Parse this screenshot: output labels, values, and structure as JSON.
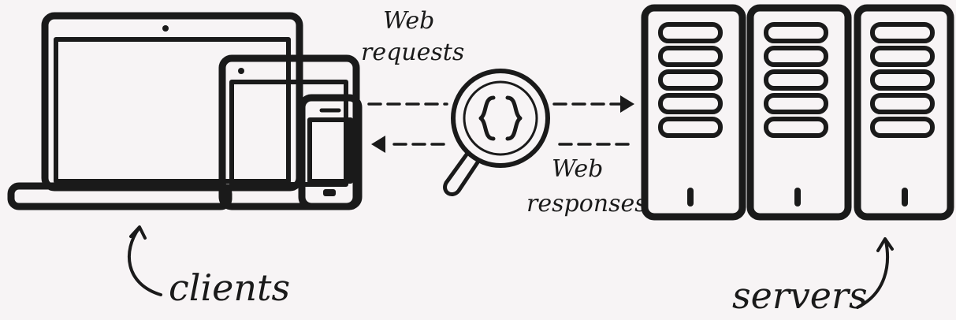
{
  "labels": {
    "web_requests_line1": "Web",
    "web_requests_line2": "requests",
    "web_responses_line1": "Web",
    "web_responses_line2": "responses",
    "clients": "clients",
    "servers": "servers"
  },
  "icons": {
    "laptop": "laptop-icon",
    "tablet": "tablet-icon",
    "phone": "phone-icon",
    "inspector": "magnifier-braces-icon",
    "server": "server-rack-icon"
  },
  "colors": {
    "background": "#f7f4f5",
    "ink": "#1a1a1a"
  }
}
